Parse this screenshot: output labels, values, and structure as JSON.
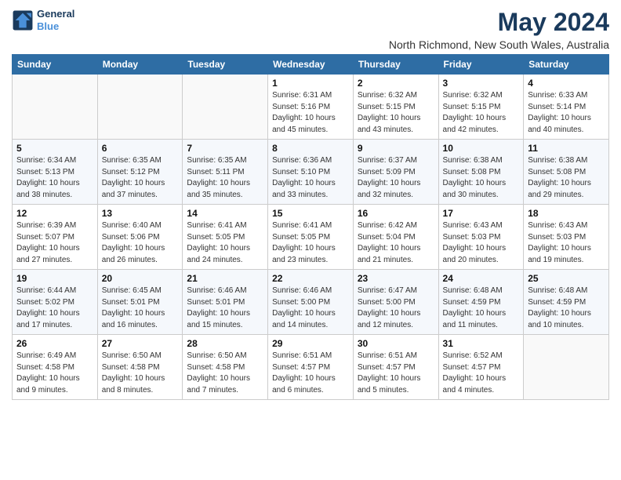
{
  "header": {
    "logo_line1": "General",
    "logo_line2": "Blue",
    "title": "May 2024",
    "subtitle": "North Richmond, New South Wales, Australia"
  },
  "days_of_week": [
    "Sunday",
    "Monday",
    "Tuesday",
    "Wednesday",
    "Thursday",
    "Friday",
    "Saturday"
  ],
  "weeks": [
    [
      {
        "day": "",
        "info": ""
      },
      {
        "day": "",
        "info": ""
      },
      {
        "day": "",
        "info": ""
      },
      {
        "day": "1",
        "info": "Sunrise: 6:31 AM\nSunset: 5:16 PM\nDaylight: 10 hours\nand 45 minutes."
      },
      {
        "day": "2",
        "info": "Sunrise: 6:32 AM\nSunset: 5:15 PM\nDaylight: 10 hours\nand 43 minutes."
      },
      {
        "day": "3",
        "info": "Sunrise: 6:32 AM\nSunset: 5:15 PM\nDaylight: 10 hours\nand 42 minutes."
      },
      {
        "day": "4",
        "info": "Sunrise: 6:33 AM\nSunset: 5:14 PM\nDaylight: 10 hours\nand 40 minutes."
      }
    ],
    [
      {
        "day": "5",
        "info": "Sunrise: 6:34 AM\nSunset: 5:13 PM\nDaylight: 10 hours\nand 38 minutes."
      },
      {
        "day": "6",
        "info": "Sunrise: 6:35 AM\nSunset: 5:12 PM\nDaylight: 10 hours\nand 37 minutes."
      },
      {
        "day": "7",
        "info": "Sunrise: 6:35 AM\nSunset: 5:11 PM\nDaylight: 10 hours\nand 35 minutes."
      },
      {
        "day": "8",
        "info": "Sunrise: 6:36 AM\nSunset: 5:10 PM\nDaylight: 10 hours\nand 33 minutes."
      },
      {
        "day": "9",
        "info": "Sunrise: 6:37 AM\nSunset: 5:09 PM\nDaylight: 10 hours\nand 32 minutes."
      },
      {
        "day": "10",
        "info": "Sunrise: 6:38 AM\nSunset: 5:08 PM\nDaylight: 10 hours\nand 30 minutes."
      },
      {
        "day": "11",
        "info": "Sunrise: 6:38 AM\nSunset: 5:08 PM\nDaylight: 10 hours\nand 29 minutes."
      }
    ],
    [
      {
        "day": "12",
        "info": "Sunrise: 6:39 AM\nSunset: 5:07 PM\nDaylight: 10 hours\nand 27 minutes."
      },
      {
        "day": "13",
        "info": "Sunrise: 6:40 AM\nSunset: 5:06 PM\nDaylight: 10 hours\nand 26 minutes."
      },
      {
        "day": "14",
        "info": "Sunrise: 6:41 AM\nSunset: 5:05 PM\nDaylight: 10 hours\nand 24 minutes."
      },
      {
        "day": "15",
        "info": "Sunrise: 6:41 AM\nSunset: 5:05 PM\nDaylight: 10 hours\nand 23 minutes."
      },
      {
        "day": "16",
        "info": "Sunrise: 6:42 AM\nSunset: 5:04 PM\nDaylight: 10 hours\nand 21 minutes."
      },
      {
        "day": "17",
        "info": "Sunrise: 6:43 AM\nSunset: 5:03 PM\nDaylight: 10 hours\nand 20 minutes."
      },
      {
        "day": "18",
        "info": "Sunrise: 6:43 AM\nSunset: 5:03 PM\nDaylight: 10 hours\nand 19 minutes."
      }
    ],
    [
      {
        "day": "19",
        "info": "Sunrise: 6:44 AM\nSunset: 5:02 PM\nDaylight: 10 hours\nand 17 minutes."
      },
      {
        "day": "20",
        "info": "Sunrise: 6:45 AM\nSunset: 5:01 PM\nDaylight: 10 hours\nand 16 minutes."
      },
      {
        "day": "21",
        "info": "Sunrise: 6:46 AM\nSunset: 5:01 PM\nDaylight: 10 hours\nand 15 minutes."
      },
      {
        "day": "22",
        "info": "Sunrise: 6:46 AM\nSunset: 5:00 PM\nDaylight: 10 hours\nand 14 minutes."
      },
      {
        "day": "23",
        "info": "Sunrise: 6:47 AM\nSunset: 5:00 PM\nDaylight: 10 hours\nand 12 minutes."
      },
      {
        "day": "24",
        "info": "Sunrise: 6:48 AM\nSunset: 4:59 PM\nDaylight: 10 hours\nand 11 minutes."
      },
      {
        "day": "25",
        "info": "Sunrise: 6:48 AM\nSunset: 4:59 PM\nDaylight: 10 hours\nand 10 minutes."
      }
    ],
    [
      {
        "day": "26",
        "info": "Sunrise: 6:49 AM\nSunset: 4:58 PM\nDaylight: 10 hours\nand 9 minutes."
      },
      {
        "day": "27",
        "info": "Sunrise: 6:50 AM\nSunset: 4:58 PM\nDaylight: 10 hours\nand 8 minutes."
      },
      {
        "day": "28",
        "info": "Sunrise: 6:50 AM\nSunset: 4:58 PM\nDaylight: 10 hours\nand 7 minutes."
      },
      {
        "day": "29",
        "info": "Sunrise: 6:51 AM\nSunset: 4:57 PM\nDaylight: 10 hours\nand 6 minutes."
      },
      {
        "day": "30",
        "info": "Sunrise: 6:51 AM\nSunset: 4:57 PM\nDaylight: 10 hours\nand 5 minutes."
      },
      {
        "day": "31",
        "info": "Sunrise: 6:52 AM\nSunset: 4:57 PM\nDaylight: 10 hours\nand 4 minutes."
      },
      {
        "day": "",
        "info": ""
      }
    ]
  ]
}
